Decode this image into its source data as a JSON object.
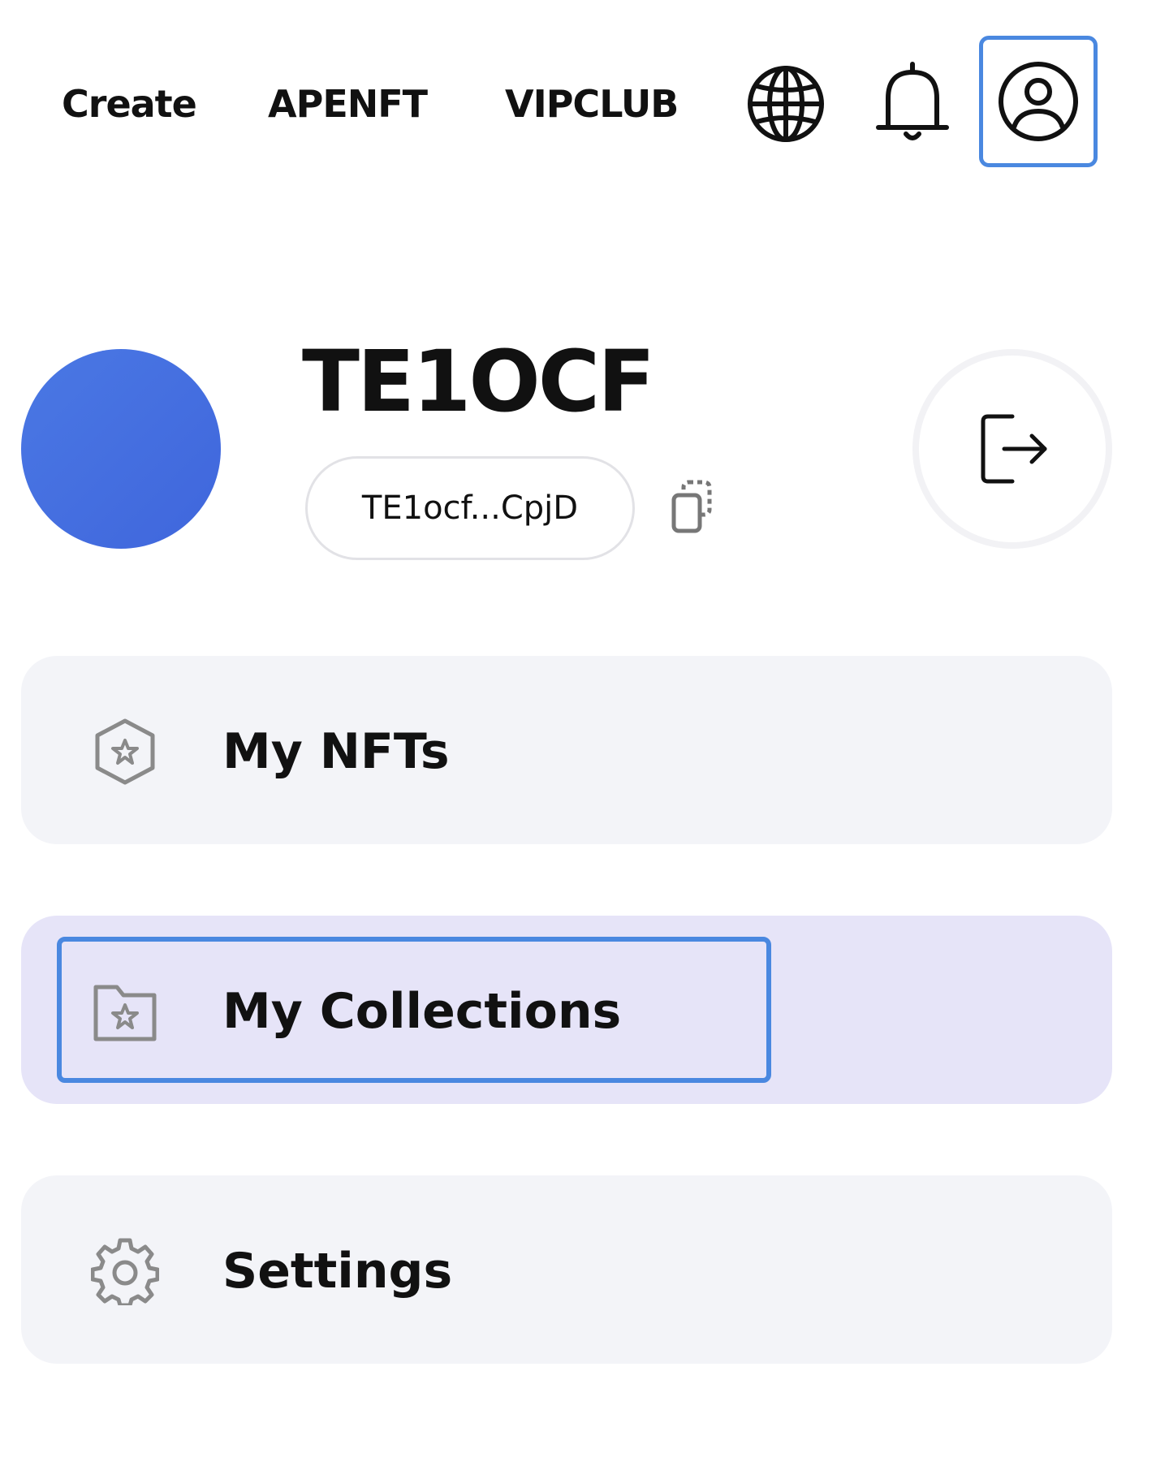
{
  "nav": {
    "links": [
      "Create",
      "APENFT",
      "VIPCLUB"
    ],
    "icons": [
      "globe-icon",
      "bell-icon",
      "account-icon"
    ],
    "focus_color": "#4a88e0"
  },
  "profile": {
    "username": "TE1OCF",
    "address": "TE1ocf...CpjD",
    "avatar_color": "#456fe0"
  },
  "menu": {
    "items": [
      {
        "label": "My NFTs",
        "icon": "nft-badge-icon",
        "active": false
      },
      {
        "label": "My Collections",
        "icon": "collection-folder-icon",
        "active": true
      },
      {
        "label": "Settings",
        "icon": "gear-icon",
        "active": false
      }
    ]
  }
}
